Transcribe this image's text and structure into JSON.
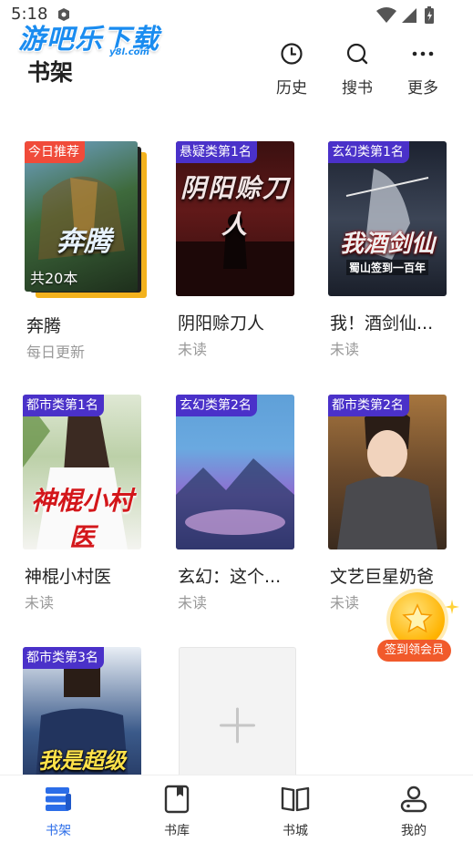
{
  "status_bar": {
    "time": "5:18"
  },
  "watermark": {
    "text": "游吧乐下载",
    "sub": "y8l.com"
  },
  "header": {
    "title": "书架",
    "actions": [
      {
        "label": "历史",
        "icon": "clock-icon"
      },
      {
        "label": "搜书",
        "icon": "search-icon"
      },
      {
        "label": "更多",
        "icon": "more-icon"
      }
    ]
  },
  "books": [
    {
      "title": "奔腾",
      "subtitle": "每日更新",
      "badge": "今日推荐",
      "count": "共20本",
      "cover_text": "奔腾"
    },
    {
      "title": "阴阳赊刀人",
      "subtitle": "未读",
      "badge": "悬疑类第1名",
      "cover_text": "阴阳赊刀人"
    },
    {
      "title": "我！酒剑仙...",
      "subtitle": "未读",
      "badge": "玄幻类第1名",
      "cover_text": "我酒剑仙",
      "cover_sub": "蜀山签到一百年"
    },
    {
      "title": "神棍小村医",
      "subtitle": "未读",
      "badge": "都市类第1名",
      "cover_text": "神棍小村医"
    },
    {
      "title": "玄幻：这个...",
      "subtitle": "未读",
      "badge": "玄幻类第2名"
    },
    {
      "title": "文艺巨星奶爸",
      "subtitle": "未读",
      "badge": "都市类第2名"
    },
    {
      "title": "",
      "subtitle": "",
      "badge": "都市类第3名",
      "cover_text": "我是超级"
    }
  ],
  "add_card": {
    "icon": "plus-icon"
  },
  "signin": {
    "label": "签到领会员"
  },
  "bottom_nav": [
    {
      "label": "书架",
      "icon": "bookshelf-icon",
      "active": true
    },
    {
      "label": "书库",
      "icon": "bookmark-book-icon",
      "active": false
    },
    {
      "label": "书城",
      "icon": "open-book-icon",
      "active": false
    },
    {
      "label": "我的",
      "icon": "profile-icon",
      "active": false
    }
  ],
  "colors": {
    "accent": "#2b6de8",
    "badge_purple": "#4a31c9",
    "badge_red": "#f04b3a",
    "signin_orange": "#f15a2b"
  }
}
